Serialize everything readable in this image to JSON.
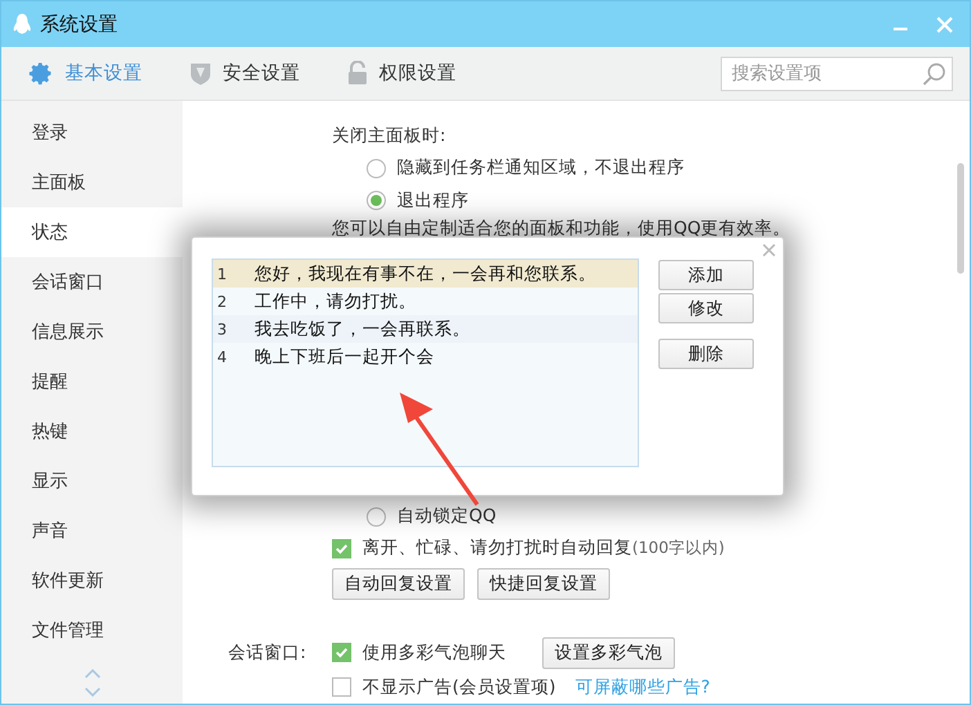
{
  "window": {
    "title": "系统设置"
  },
  "tabs": [
    {
      "label": "基本设置",
      "selected": true,
      "kind": "gear"
    },
    {
      "label": "安全设置",
      "selected": false,
      "kind": "shield"
    },
    {
      "label": "权限设置",
      "selected": false,
      "kind": "lock"
    }
  ],
  "search": {
    "placeholder": "搜索设置项"
  },
  "sidebar": {
    "items": [
      {
        "label": "登录",
        "selected": false
      },
      {
        "label": "主面板",
        "selected": false
      },
      {
        "label": "状态",
        "selected": true
      },
      {
        "label": "会话窗口",
        "selected": false
      },
      {
        "label": "信息展示",
        "selected": false
      },
      {
        "label": "提醒",
        "selected": false
      },
      {
        "label": "热键",
        "selected": false
      },
      {
        "label": "显示",
        "selected": false
      },
      {
        "label": "声音",
        "selected": false
      },
      {
        "label": "软件更新",
        "selected": false
      },
      {
        "label": "文件管理",
        "selected": false
      }
    ]
  },
  "panel_close": {
    "label": "关闭主面板时:",
    "options": [
      {
        "label": "隐藏到任务栏通知区域，不退出程序",
        "selected": false
      },
      {
        "label": "退出程序",
        "selected": true
      }
    ]
  },
  "customize_note": "您可以自由定制适合您的面板和功能，使用QQ更有效率。",
  "auto_lock": {
    "label": "自动锁定QQ",
    "selected": false
  },
  "auto_reply": {
    "label": "离开、忙碌、请勿打扰时自动回复",
    "hint": "(100字以内)",
    "checked": true,
    "buttons": [
      "自动回复设置",
      "快捷回复设置"
    ]
  },
  "chat_window": {
    "label": "会话窗口:",
    "options": [
      {
        "label": "使用多彩气泡聊天",
        "checked": true,
        "button": "设置多彩气泡"
      },
      {
        "label": "不显示广告(会员设置项)",
        "checked": false,
        "link": "可屏蔽哪些广告?"
      }
    ]
  },
  "dialog": {
    "rows": [
      {
        "index": "1",
        "text": "您好，我现在有事不在，一会再和您联系。",
        "selected": true
      },
      {
        "index": "2",
        "text": "工作中，请勿打扰。",
        "selected": false
      },
      {
        "index": "3",
        "text": "我去吃饭了，一会再联系。",
        "selected": false
      },
      {
        "index": "4",
        "text": "晚上下班后一起开个会",
        "selected": false
      }
    ],
    "buttons": [
      "添加",
      "修改",
      "删除"
    ]
  }
}
